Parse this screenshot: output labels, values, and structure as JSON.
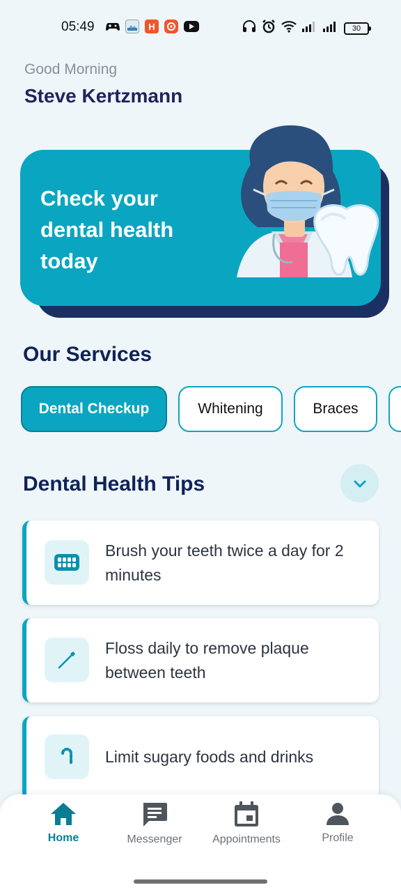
{
  "status_bar": {
    "time": "05:49",
    "battery": "30",
    "icons": [
      "gamepad-icon",
      "photo-icon",
      "h-app-icon",
      "music-app-icon",
      "youtube-icon",
      "headphones-icon",
      "alarm-icon",
      "wifi-icon",
      "signal-icon",
      "signal-icon"
    ]
  },
  "header": {
    "greeting": "Good Morning",
    "name": "Steve Kertzmann"
  },
  "hero": {
    "text": "Check your dental health today"
  },
  "services": {
    "title": "Our Services",
    "items": [
      "Dental Checkup",
      "Whitening",
      "Braces"
    ]
  },
  "tips": {
    "title": "Dental Health Tips",
    "items": [
      {
        "icon": "teeth-icon",
        "text": "Brush your teeth twice a day for 2 minutes"
      },
      {
        "icon": "floss-icon",
        "text": "Floss daily to remove plaque between teeth"
      },
      {
        "icon": "candy-cane-icon",
        "text": "Limit sugary foods and drinks"
      }
    ]
  },
  "nav": {
    "items": [
      {
        "label": "Home",
        "icon": "home-icon",
        "active": true
      },
      {
        "label": "Messenger",
        "icon": "message-icon"
      },
      {
        "label": "Appointments",
        "icon": "calendar-icon"
      },
      {
        "label": "Profile",
        "icon": "person-icon"
      }
    ]
  },
  "colors": {
    "accent": "#0aa6c1",
    "hero_shadow": "#1b2f63",
    "title": "#0f2357",
    "nav_active": "#0a7d94"
  }
}
